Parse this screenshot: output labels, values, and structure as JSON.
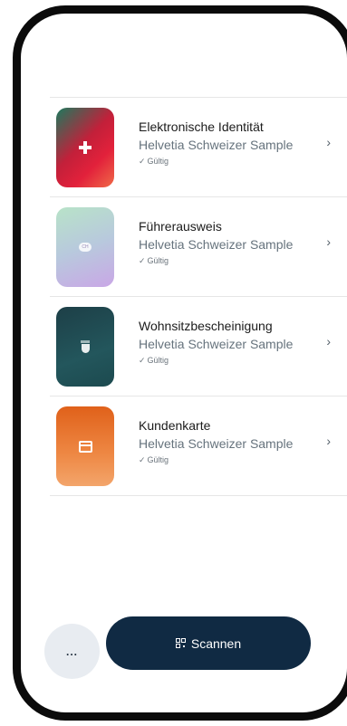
{
  "credentials": [
    {
      "title": "Elektronische Identität",
      "issuer": "Helvetia Schweizer Sample",
      "status": "Gültig",
      "icon": "swiss-cross-icon"
    },
    {
      "title": "Führerausweis",
      "issuer": "Helvetia Schweizer Sample",
      "status": "Gültig",
      "icon": "ch-badge-icon",
      "badge_text": "CH"
    },
    {
      "title": "Wohnsitzbescheinigung",
      "issuer": "Helvetia Schweizer Sample",
      "status": "Gültig",
      "icon": "bern-crest-icon"
    },
    {
      "title": "Kundenkarte",
      "issuer": "Helvetia Schweizer Sample",
      "status": "Gültig",
      "icon": "shop-icon"
    }
  ],
  "status_check_glyph": "✓",
  "chevron_glyph": "›",
  "bottom_bar": {
    "more_label": "...",
    "scan_label": "Scannen"
  },
  "colors": {
    "primary": "#102a43",
    "more_button_bg": "#e8ecf1",
    "divider": "#e6e6e6"
  }
}
